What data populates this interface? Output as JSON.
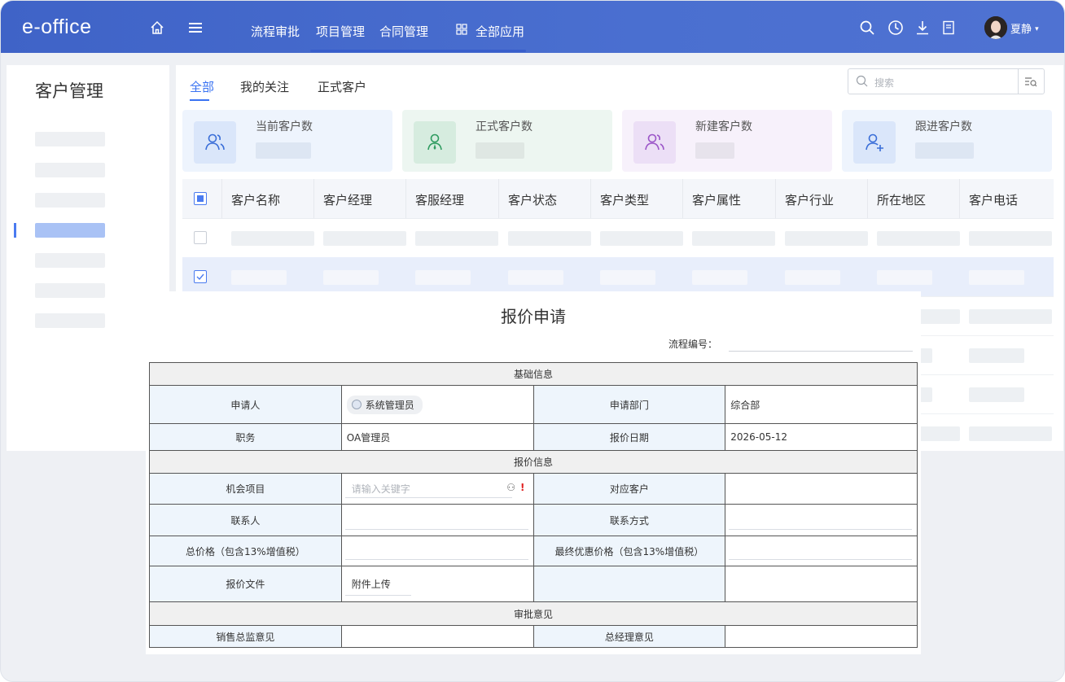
{
  "app": {
    "logo": "e-office"
  },
  "topbar": {
    "nav": [
      "流程审批",
      "项目管理",
      "合同管理",
      "全部应用"
    ],
    "user": "夏静",
    "colors": {
      "bar": "#4a6fd0",
      "accent": "#3a73f2"
    }
  },
  "sidebar": {
    "title": "客户管理"
  },
  "tabs": [
    "全部",
    "我的关注",
    "正式客户"
  ],
  "search": {
    "placeholder": "搜索"
  },
  "stats": [
    {
      "label": "当前客户数",
      "icon": "users-icon"
    },
    {
      "label": "正式客户数",
      "icon": "user-icon"
    },
    {
      "label": "新建客户数",
      "icon": "users-icon"
    },
    {
      "label": "跟进客户数",
      "icon": "user-add-icon"
    }
  ],
  "table": {
    "columns": [
      "客户名称",
      "客户经理",
      "客服经理",
      "客户状态",
      "客户类型",
      "客户属性",
      "客户行业",
      "所在地区",
      "客户电话"
    ]
  },
  "form": {
    "title": "报价申请",
    "flow_no_label": "流程编号：",
    "sections": {
      "basic": "基础信息",
      "quote": "报价信息",
      "approval": "审批意见"
    },
    "applicant_label": "申请人",
    "applicant_value": "系统管理员",
    "dept_label": "申请部门",
    "dept_value": "综合部",
    "position_label": "职务",
    "position_value": "OA管理员",
    "quote_date_label": "报价日期",
    "quote_date_value": "2026-05-12",
    "project_label": "机会项目",
    "project_placeholder": "请输入关键字",
    "customer_label": "对应客户",
    "contact_label": "联系人",
    "contact_method_label": "联系方式",
    "total_price_label": "总价格（包含13%增值税）",
    "final_price_label": "最终优惠价格（包含13%增值税）",
    "quote_file_label": "报价文件",
    "attachment_label": "附件上传",
    "sales_opinion_label": "销售总监意见",
    "gm_opinion_label": "总经理意见"
  }
}
